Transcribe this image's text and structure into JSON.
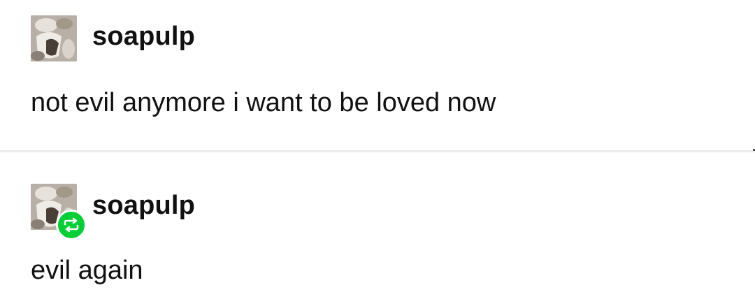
{
  "posts": [
    {
      "username": "soapulp",
      "text": "not evil anymore i want to be loved now",
      "avatar_icon": "user-avatar",
      "reblogged": false
    },
    {
      "username": "soapulp",
      "text": "evil again",
      "avatar_icon": "user-avatar",
      "reblogged": true,
      "badge_icon": "reblog-icon",
      "badge_color": "#00cf35"
    }
  ]
}
